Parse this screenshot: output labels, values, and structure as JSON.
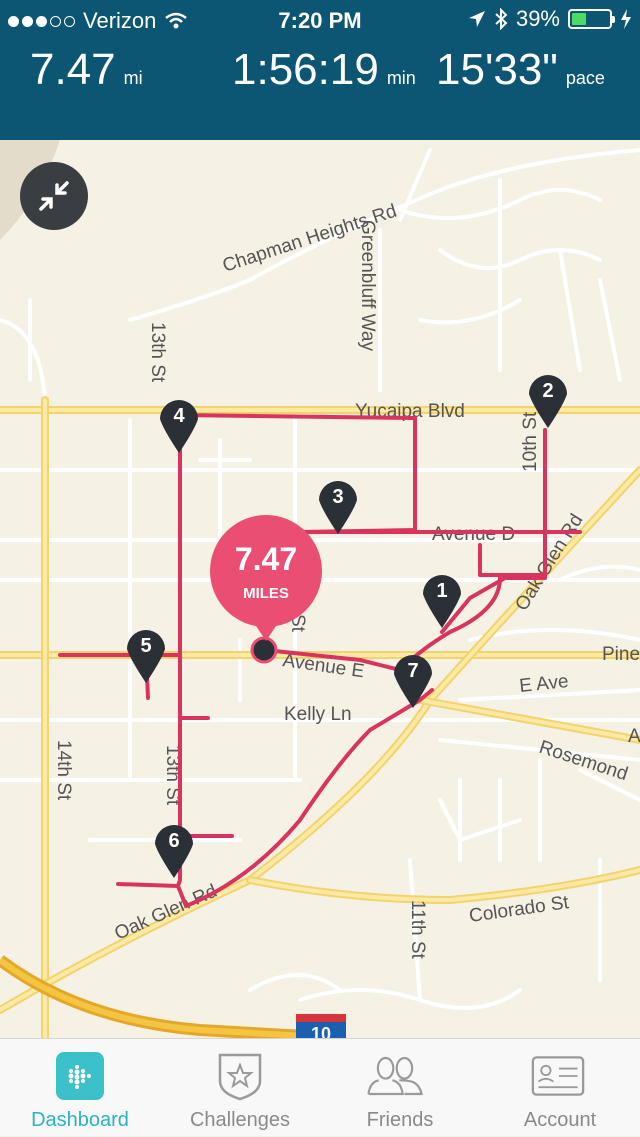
{
  "status_bar": {
    "carrier": "Verizon",
    "time": "7:20 PM",
    "battery": "39%",
    "battery_level": 0.39,
    "signal_bars_full": 3,
    "signal_bars_total": 5
  },
  "stats": {
    "distance_value": "7.47",
    "distance_unit": "mi",
    "duration_value": "1:56:19",
    "duration_unit": "min",
    "pace_value": "15'33\"",
    "pace_unit": "pace"
  },
  "map": {
    "street_labels": {
      "chapman": "Chapman Heights Rd",
      "greenbluff": "Greenbluff Way",
      "thirteenth_north": "13th St",
      "yucaipa": "Yucaipa Blvd",
      "avenue_d": "Avenue D",
      "tenth": "10th St",
      "oak_glen_east": "Oak Glen Rd",
      "pine": "Pine",
      "e_ave": "E Ave",
      "avenue_e": "Avenue E",
      "kelly": "Kelly Ln",
      "rosemond": "Rosemond",
      "a_edge": "A",
      "fourteenth": "14th St",
      "thirteenth_south": "13th St",
      "oak_glen_west": "Oak Glen Rd",
      "colorado": "Colorado St",
      "eleventh": "11th St",
      "st_fragment": "St",
      "interstate": "10"
    },
    "markers": [
      "1",
      "2",
      "3",
      "4",
      "5",
      "6",
      "7"
    ],
    "current_badge": {
      "value": "7.47",
      "unit": "MILES"
    },
    "route_color": "#d8345f"
  },
  "tabs": [
    {
      "label": "Dashboard",
      "icon": "fitbit-dots-icon",
      "active": true
    },
    {
      "label": "Challenges",
      "icon": "star-badge-icon",
      "active": false
    },
    {
      "label": "Friends",
      "icon": "friends-icon",
      "active": false
    },
    {
      "label": "Account",
      "icon": "id-card-icon",
      "active": false
    }
  ],
  "colors": {
    "header": "#0c5673",
    "accent": "#2ab3c0",
    "route": "#d8345f",
    "badge": "#ea4f73",
    "marker": "#2b2f36",
    "map_bg": "#f6f1e5",
    "major_road": "#f3d36b"
  }
}
